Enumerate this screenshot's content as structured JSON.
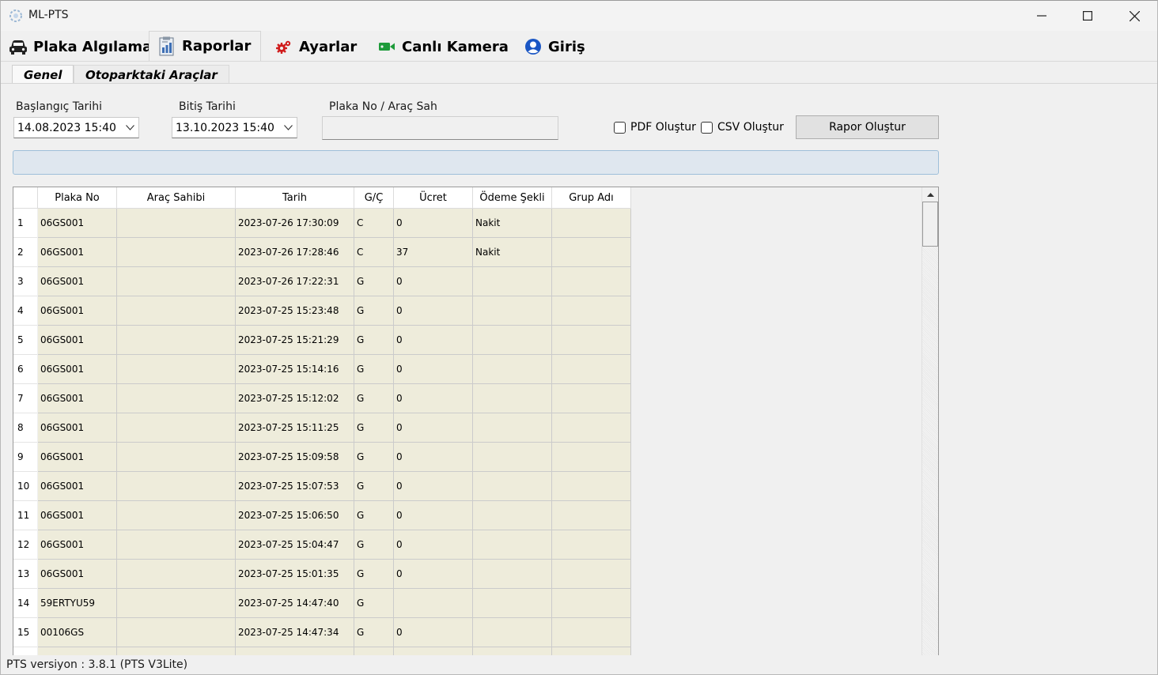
{
  "window": {
    "title": "ML-PTS"
  },
  "main_tabs": [
    {
      "label": "Plaka Algılama",
      "icon": "car-icon"
    },
    {
      "label": "Raporlar",
      "icon": "report-icon"
    },
    {
      "label": "Ayarlar",
      "icon": "gears-icon"
    },
    {
      "label": "Canlı Kamera",
      "icon": "video-camera-icon"
    },
    {
      "label": "Giriş",
      "icon": "user-icon"
    }
  ],
  "sub_tabs": [
    {
      "label": "Genel"
    },
    {
      "label": "Otoparktaki Araçlar"
    }
  ],
  "filters": {
    "start_label": "Başlangıç Tarihi",
    "start_value": "14.08.2023 15:40",
    "end_label": "Bitiş Tarihi",
    "end_value": "13.10.2023 15:40",
    "plate_label": "Plaka No / Araç Sah",
    "plate_value": "",
    "pdf_label": "PDF Oluştur",
    "pdf_checked": false,
    "csv_label": "CSV Oluştur",
    "csv_checked": false,
    "report_button": "Rapor Oluştur"
  },
  "progress": {
    "value": 0
  },
  "table": {
    "columns": [
      "Plaka No",
      "Araç Sahibi",
      "Tarih",
      "G/Ç",
      "Ücret",
      "Ödeme Şekli",
      "Grup Adı"
    ],
    "rows": [
      [
        "1",
        "06GS001",
        "",
        "2023-07-26 17:30:09",
        "C",
        "0",
        "Nakit",
        ""
      ],
      [
        "2",
        "06GS001",
        "",
        "2023-07-26 17:28:46",
        "C",
        "37",
        "Nakit",
        ""
      ],
      [
        "3",
        "06GS001",
        "",
        "2023-07-26 17:22:31",
        "G",
        "0",
        "",
        ""
      ],
      [
        "4",
        "06GS001",
        "",
        "2023-07-25 15:23:48",
        "G",
        "0",
        "",
        ""
      ],
      [
        "5",
        "06GS001",
        "",
        "2023-07-25 15:21:29",
        "G",
        "0",
        "",
        ""
      ],
      [
        "6",
        "06GS001",
        "",
        "2023-07-25 15:14:16",
        "G",
        "0",
        "",
        ""
      ],
      [
        "7",
        "06GS001",
        "",
        "2023-07-25 15:12:02",
        "G",
        "0",
        "",
        ""
      ],
      [
        "8",
        "06GS001",
        "",
        "2023-07-25 15:11:25",
        "G",
        "0",
        "",
        ""
      ],
      [
        "9",
        "06GS001",
        "",
        "2023-07-25 15:09:58",
        "G",
        "0",
        "",
        ""
      ],
      [
        "10",
        "06GS001",
        "",
        "2023-07-25 15:07:53",
        "G",
        "0",
        "",
        ""
      ],
      [
        "11",
        "06GS001",
        "",
        "2023-07-25 15:06:50",
        "G",
        "0",
        "",
        ""
      ],
      [
        "12",
        "06GS001",
        "",
        "2023-07-25 15:04:47",
        "G",
        "0",
        "",
        ""
      ],
      [
        "13",
        "06GS001",
        "",
        "2023-07-25 15:01:35",
        "G",
        "0",
        "",
        ""
      ],
      [
        "14",
        "59ERTYU59",
        "",
        "2023-07-25 14:47:40",
        "G",
        "",
        "",
        ""
      ],
      [
        "15",
        "00106GS",
        "",
        "2023-07-25 14:47:34",
        "G",
        "0",
        "",
        ""
      ]
    ]
  },
  "status": {
    "text": "PTS versiyon : 3.8.1 (PTS V3Lite)"
  }
}
